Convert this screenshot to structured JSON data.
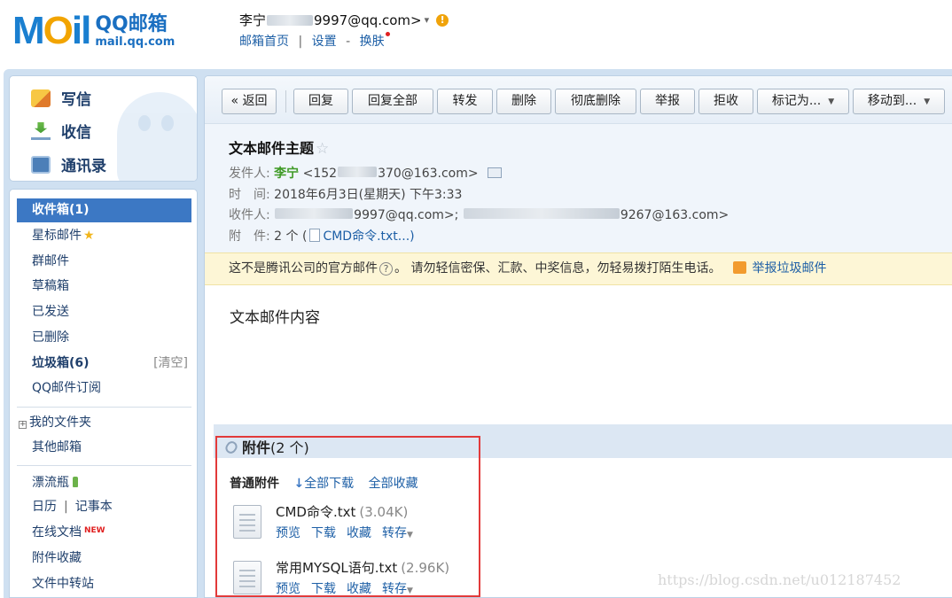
{
  "header": {
    "logo_main": "MOil",
    "logo_cn": "QQ邮箱",
    "logo_en": "mail.qq.com",
    "user_name": "李宁",
    "user_email_tail": "9997@qq.com>",
    "caret": "▾",
    "alert": "!",
    "links": [
      "邮箱首页",
      "设置",
      "换肤"
    ],
    "sep1": "|",
    "sep2": "-"
  },
  "quick_actions": [
    {
      "label": "写信",
      "icon": "write-icon"
    },
    {
      "label": "收信",
      "icon": "inbox-download-icon"
    },
    {
      "label": "通讯录",
      "icon": "contacts-icon"
    }
  ],
  "sidebar": {
    "items": [
      {
        "label": "收件箱(1)"
      },
      {
        "label": "星标邮件"
      },
      {
        "label": "群邮件"
      },
      {
        "label": "草稿箱"
      },
      {
        "label": "已发送"
      },
      {
        "label": "已删除"
      },
      {
        "label": "垃圾箱(6)",
        "extra": "[清空]"
      },
      {
        "label": "QQ邮件订阅"
      },
      {
        "label": "我的文件夹"
      },
      {
        "label": "其他邮箱"
      },
      {
        "label": "漂流瓶"
      },
      {
        "label": "日历",
        "extra_sep": "|",
        "extra": "记事本"
      },
      {
        "label": "在线文档",
        "badge": "NEW"
      },
      {
        "label": "附件收藏"
      },
      {
        "label": "文件中转站"
      }
    ],
    "plus": "+",
    "star": "★"
  },
  "toolbar": {
    "back": "« 返回",
    "reply": "回复",
    "reply_all": "回复全部",
    "forward": "转发",
    "delete": "删除",
    "delete_perm": "彻底删除",
    "report": "举报",
    "reject": "拒收",
    "mark_as": "标记为...",
    "move_to": "移动到...",
    "dropdown": "▼"
  },
  "mail": {
    "subject": "文本邮件主题",
    "subject_star": "☆",
    "from_label": "发件人:",
    "from_name": "李宁",
    "from_email_head": "<152",
    "from_email_tail": "370@163.com>",
    "time_label": "时　间:",
    "time_value": "2018年6月3日(星期天) 下午3:33",
    "to_label": "收件人:",
    "to_value_1": "9997@qq.com>;",
    "to_value_2": "9267@163.com>",
    "att_label": "附　件:",
    "att_count": "2 个 (",
    "att_link": "CMD命令.txt...)",
    "warning": "这不是腾讯公司的官方邮件",
    "warning_q": "?",
    "warning_tail": "。 请勿轻信密保、汇款、中奖信息，勿轻易拨打陌生电话。",
    "report_spam": "举报垃圾邮件",
    "body": "文本邮件内容"
  },
  "attachments": {
    "title": "附件",
    "count": "(2 个)",
    "section": "普通附件",
    "arrow": "↓",
    "download_all": "全部下载",
    "collect_all": "全部收藏",
    "files": [
      {
        "name": "CMD命令.txt",
        "size": "(3.04K)"
      },
      {
        "name": "常用MYSQL语句.txt",
        "size": "(2.96K)"
      }
    ],
    "actions": [
      "预览",
      "下载",
      "收藏",
      "转存"
    ],
    "dd": "▼"
  },
  "watermark": "https://blog.csdn.net/u012187452"
}
